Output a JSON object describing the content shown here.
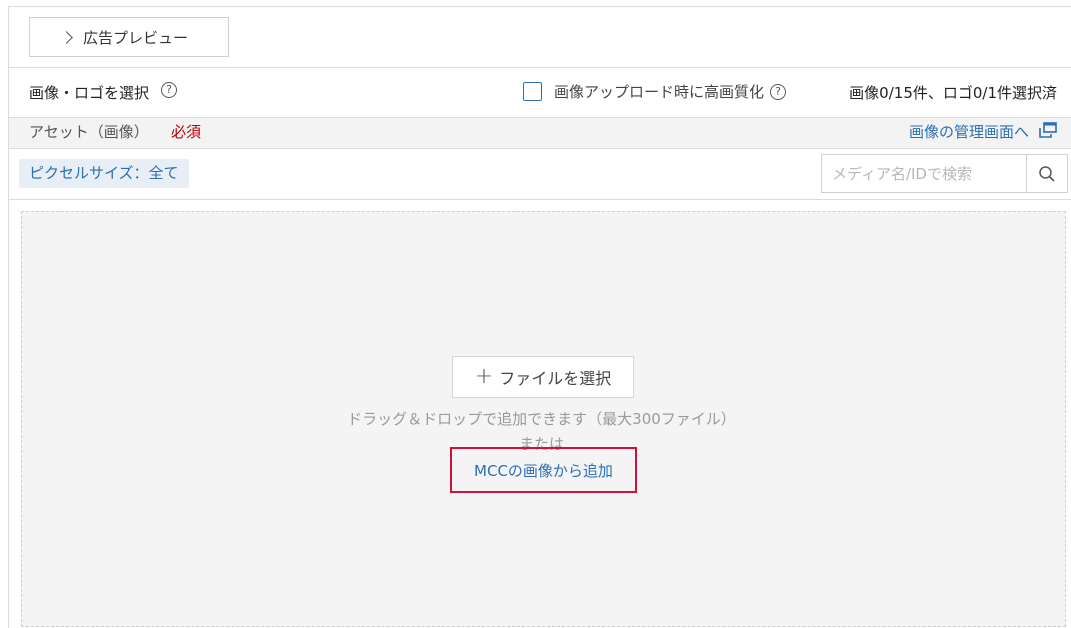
{
  "preview": {
    "label": "広告プレビュー"
  },
  "selector": {
    "title": "画像・ロゴを選択",
    "help": "?",
    "high_quality_label": "画像アップロード時に高画質化",
    "count_text": "画像0/15件、ロゴ0/1件選択済"
  },
  "asset": {
    "label": "アセット（画像）",
    "required": "必須",
    "manage_link": "画像の管理画面へ"
  },
  "filter": {
    "pixel_size": "ピクセルサイズ：全て"
  },
  "search": {
    "placeholder": "メディア名/IDで検索"
  },
  "dropzone": {
    "file_button": "ファイルを選択",
    "plus": "+",
    "drag_text": "ドラッグ＆ドロップで追加できます（最大300ファイル）",
    "or_text": "または",
    "mcc_link": "MCCの画像から追加"
  },
  "colors": {
    "link": "#2c6fb3",
    "required": "#c00000",
    "highlight_border": "#d0103a"
  }
}
